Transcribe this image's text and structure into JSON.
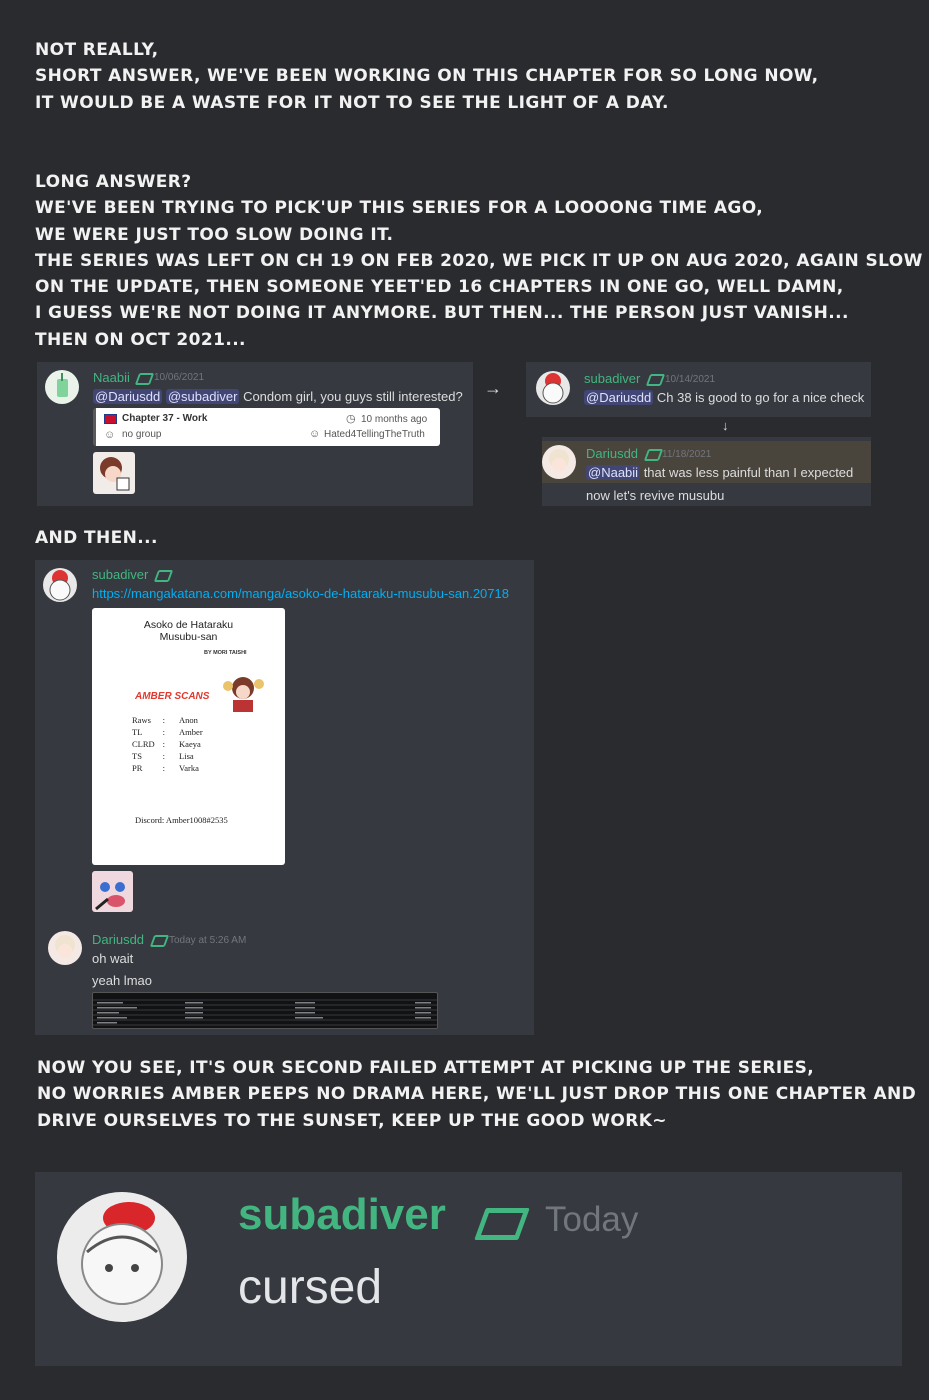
{
  "narration": {
    "intro_lines": [
      "NOT REALLY,",
      "SHORT ANSWER, WE'VE BEEN WORKING ON THIS CHAPTER FOR SO LONG NOW,",
      "IT WOULD BE A WASTE FOR IT NOT TO SEE THE LIGHT OF A DAY."
    ],
    "long_lines": [
      "LONG ANSWER?",
      "WE'VE BEEN TRYING TO PICK'UP THIS SERIES FOR A LOOOONG TIME AGO,",
      "WE WERE JUST TOO SLOW DOING IT.",
      "THE SERIES WAS LEFT ON CH 19 ON FEB 2020, WE PICK IT UP ON AUG 2020, AGAIN SLOW",
      "ON THE UPDATE, THEN SOMEONE YEET'ED 16 CHAPTERS IN ONE GO, WELL DAMN,",
      "I GUESS WE'RE NOT DOING IT ANYMORE. BUT THEN... THE PERSON JUST VANISH...",
      "THEN ON OCT 2021..."
    ],
    "and_then": "AND THEN...",
    "outro_lines": [
      "NOW YOU SEE, IT'S OUR SECOND FAILED ATTEMPT AT PICKING UP THE SERIES,",
      "NO WORRIES AMBER PEEPS NO DRAMA HERE, WE'LL JUST DROP THIS ONE CHAPTER AND",
      "DRIVE OURSELVES TO THE SUNSET, KEEP UP THE GOOD WORK~"
    ]
  },
  "panel1": {
    "user": "Naabii",
    "time": "10/06/2021",
    "mention1": "@Dariusdd",
    "mention2": "@subadiver",
    "text": "Condom girl, you guys still interested?",
    "card": {
      "title": "Chapter 37 - Work",
      "group": "no group",
      "time": "10 months ago",
      "uploader": "Hated4TellingTheTruth"
    }
  },
  "panel2": {
    "user": "subadiver",
    "time": "10/14/2021",
    "mention": "@Dariusdd",
    "text": "Ch 38 is good to go for a nice check"
  },
  "panel3": {
    "user": "Dariusdd",
    "time": "11/18/2021",
    "mention": "@Naabii",
    "text": "that was less painful than I expected",
    "text2": "now let's revive musubu"
  },
  "panel4": {
    "user1": "subadiver",
    "link": "https://mangakatana.com/manga/asoko-de-hataraku-musubu-san.20718",
    "credits_card": {
      "title_line1": "Asoko de Hataraku",
      "title_line2": "Musubu-san",
      "author": "BY MORI TAISHI",
      "scans": "AMBER SCANS",
      "rows": [
        {
          "role": "Raws",
          "sep": ":",
          "name": "Anon"
        },
        {
          "role": "TL",
          "sep": ":",
          "name": "Amber"
        },
        {
          "role": "CLRD",
          "sep": ":",
          "name": "Kaeya"
        },
        {
          "role": "TS",
          "sep": ":",
          "name": "Lisa"
        },
        {
          "role": "PR",
          "sep": ":",
          "name": "Varka"
        }
      ],
      "discord": "Discord: Amber1008#2535"
    },
    "user2": "Dariusdd",
    "time2": "Today at 5:26 AM",
    "msg1": "oh wait",
    "msg2": "yeah lmao"
  },
  "panel5": {
    "user": "subadiver",
    "time": "Today",
    "text": "cursed"
  },
  "colors": {
    "background": "#2a2b2e",
    "panel": "#36393f",
    "username": "#43b581",
    "mention_bg": "#414675",
    "link": "#00aff4",
    "amber_scans": "#e03a2f"
  }
}
